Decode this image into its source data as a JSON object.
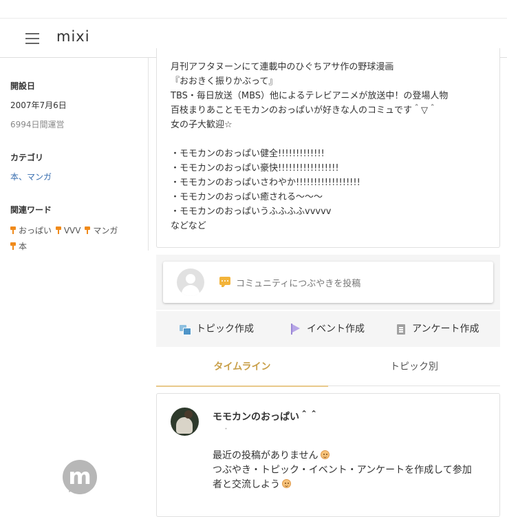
{
  "app": {
    "logo": "mixi"
  },
  "sidebar": {
    "founded_heading": "開設日",
    "founded_date": "2007年7月6日",
    "running_days": "6994日間運営",
    "category_heading": "カテゴリ",
    "category_value": "本、マンガ",
    "keywords_heading": "関連ワード",
    "keywords": [
      "おっぱい",
      "VVV",
      "マンガ",
      "本"
    ]
  },
  "description": {
    "lines": [
      "月刊アフタヌーンにて連載中のひぐちアサ作の野球漫画",
      "『おおきく振りかぶって』",
      "TBS・毎日放送（MBS）他によるテレビアニメが放送中！の登場人物",
      "百枝まりあことモモカンのおっぱいが好きな人のコミュです＾▽＾",
      "女の子大歓迎☆",
      "",
      "・モモカンのおっぱい健全!!!!!!!!!!!!!",
      "・モモカンのおっぱい豪快!!!!!!!!!!!!!!!!!",
      "・モモカンのおっぱいさわやか!!!!!!!!!!!!!!!!!!",
      "・モモカンのおっぱい癒される〜〜〜",
      "・モモカンのおっぱいうふふふふvvvvv",
      "などなど"
    ]
  },
  "post": {
    "placeholder": "コミュニティにつぶやきを投稿"
  },
  "actions": {
    "topic": "トピック作成",
    "event": "イベント作成",
    "survey": "アンケート作成"
  },
  "tabs": {
    "timeline": "タイムライン",
    "by_topic": "トピック別"
  },
  "timeline": {
    "community_name": "モモカンのおっぱい＾＾",
    "dot": "・",
    "line1": "最近の投稿がありません",
    "line2": "つぶやき・トピック・イベント・アンケートを作成して参加",
    "line3": "者と交流しよう"
  },
  "footer": {
    "badge_letter": "m"
  }
}
